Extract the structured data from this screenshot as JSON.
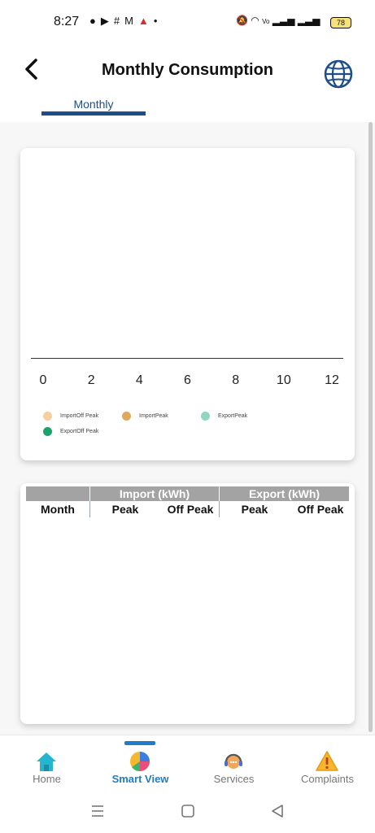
{
  "status_bar": {
    "time": "8:27",
    "battery": "78",
    "icons": [
      "chat-icon",
      "youtube-icon",
      "hashtag-icon",
      "gmail-icon",
      "nav-arrow-icon",
      "dot-icon"
    ],
    "right_icons": [
      "mute-icon",
      "wifi-icon",
      "volte-icon",
      "signal-icon",
      "signal-icon"
    ]
  },
  "header": {
    "title": "Monthly Consumption",
    "back_icon": "back-chevron-icon",
    "language_icon": "globe-icon"
  },
  "tabs": [
    {
      "label": "Monthly",
      "active": true
    }
  ],
  "chart_data": {
    "type": "bar",
    "x_ticks": [
      "0",
      "2",
      "4",
      "6",
      "8",
      "10",
      "12"
    ],
    "xlim": [
      0,
      12
    ],
    "series": [
      {
        "name": "ImportOff Peak",
        "color": "#f6cfa0",
        "values": []
      },
      {
        "name": "ImportPeak",
        "color": "#e0a85a",
        "values": []
      },
      {
        "name": "ExportPeak",
        "color": "#8fd5bf",
        "values": []
      },
      {
        "name": "ExportOff Peak",
        "color": "#1aa36a",
        "values": []
      }
    ],
    "legend_position": "bottom-left"
  },
  "table": {
    "group_headers": [
      "Import (kWh)",
      "Export (kWh)"
    ],
    "columns": [
      "Month",
      "Peak",
      "Off Peak",
      "Peak",
      "Off Peak"
    ],
    "rows": []
  },
  "bottom_nav": [
    {
      "label": "Home",
      "icon": "home-icon",
      "active": false
    },
    {
      "label": "Smart View",
      "icon": "pie-chart-icon",
      "active": true
    },
    {
      "label": "Services",
      "icon": "support-agent-icon",
      "active": false
    },
    {
      "label": "Complaints",
      "icon": "warning-icon",
      "active": false
    }
  ],
  "colors": {
    "accent": "#1e7cc8",
    "tab_blue": "#1d4e89",
    "table_header": "#a3a3a3"
  }
}
